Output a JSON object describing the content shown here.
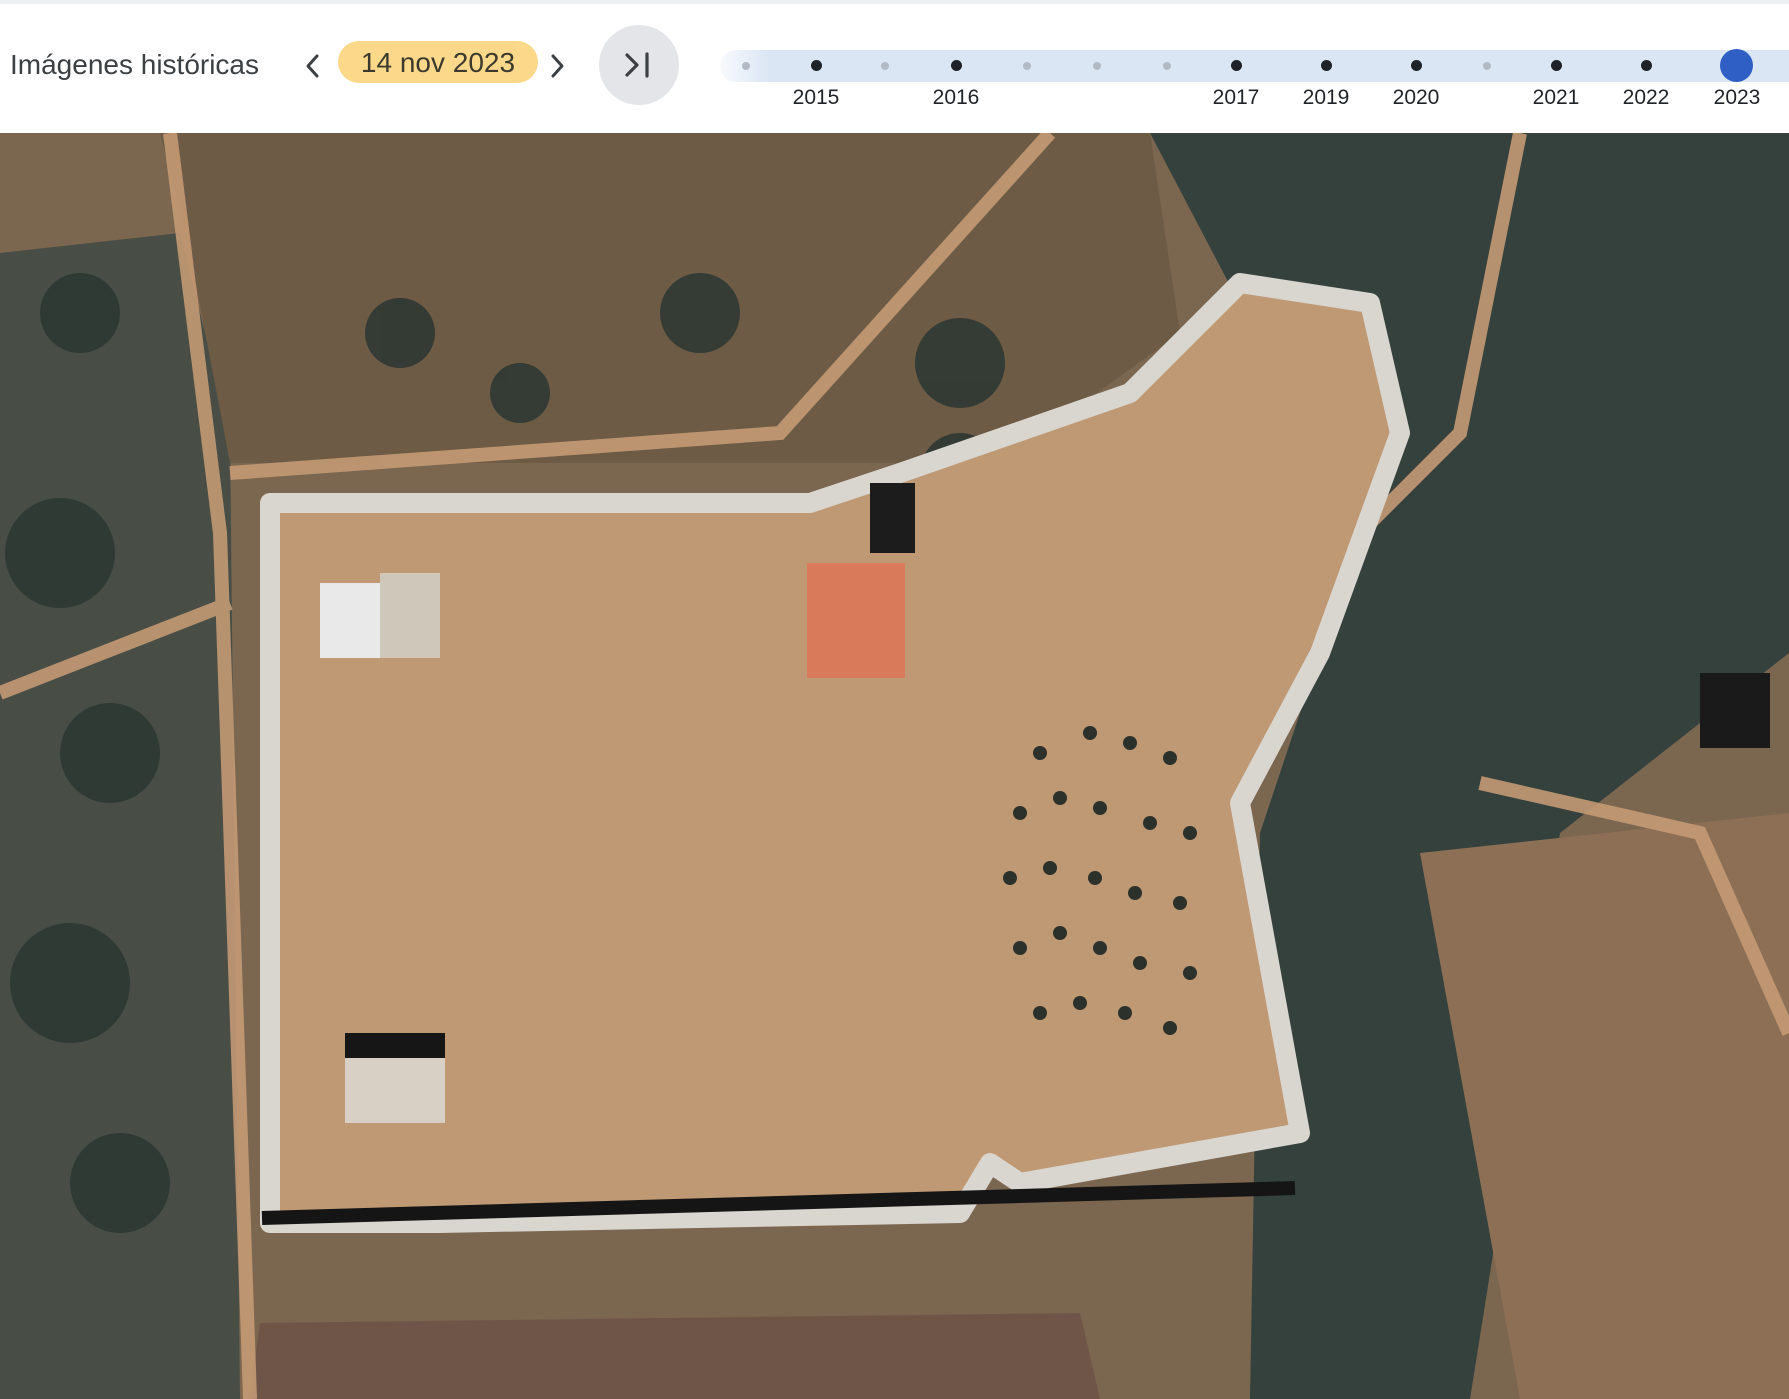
{
  "header": {
    "title": "Imágenes históricas",
    "date": "14 nov 2023",
    "prev_icon": "chevron-left-icon",
    "next_icon": "chevron-right-icon",
    "latest_icon": "skip-to-latest-icon"
  },
  "timeline": {
    "years": [
      "2015",
      "2016",
      "2017",
      "2019",
      "2020",
      "2021",
      "2022",
      "2023"
    ],
    "selected_year": "2023",
    "colors": {
      "track": "#dbe6f4",
      "selected": "#2f5fc4",
      "major": "#1f2328",
      "minor": "#b2bac6"
    }
  },
  "map": {
    "type": "satellite imagery",
    "colors": {
      "soil": "#b48c64",
      "vegetation": "#3a4a43",
      "path": "#d9d5cf",
      "roof": "#d97a5a"
    }
  }
}
